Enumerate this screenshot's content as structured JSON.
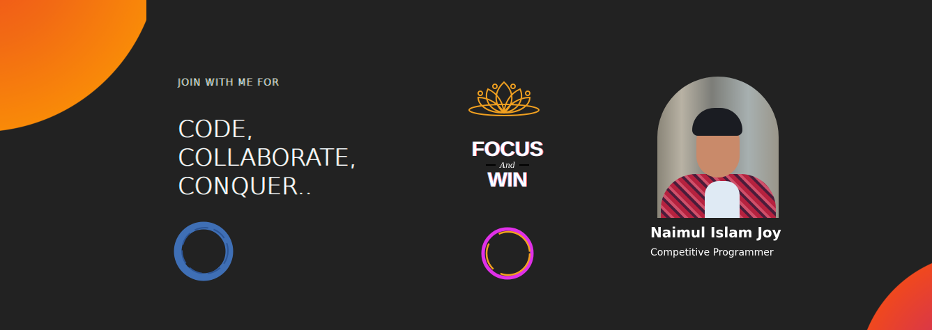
{
  "hero": {
    "kicker": "JOIN WITH ME FOR",
    "headline": [
      "CODE,",
      "COLLABORATE,",
      "CONQUER.."
    ]
  },
  "badge": {
    "icon": "lotus-icon",
    "line1": "FOCUS",
    "line2": "And",
    "line3": "WIN"
  },
  "profile": {
    "name": "Naimul Islam Joy",
    "role": "Competitive Programmer"
  },
  "colors": {
    "background": "#222222",
    "accent_orange": "#f98a08",
    "lotus": "#f0a020",
    "ring_blue": "#3f6fb5",
    "ring_pink": "#e030e8"
  }
}
